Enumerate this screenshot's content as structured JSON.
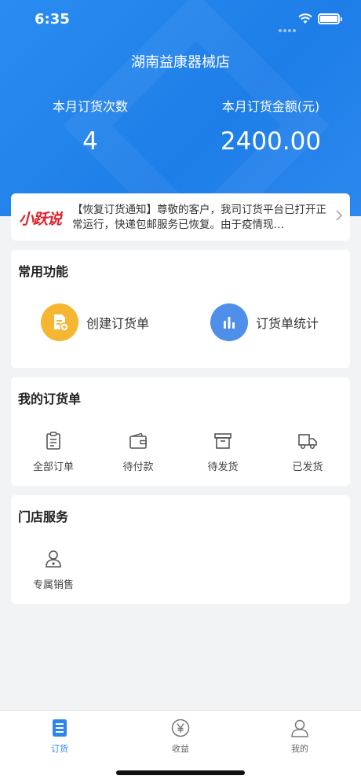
{
  "status_bar": {
    "time": "6:35"
  },
  "header": {
    "store_name": "湖南益康器械店",
    "stats": [
      {
        "label": "本月订货次数",
        "value": "4"
      },
      {
        "label": "本月订货金额(元)",
        "value": "2400.00"
      }
    ]
  },
  "notice": {
    "logo": "小跃说",
    "text": "【恢复订货通知】尊敬的客户，我司订货平台已打开正常运行，快递包邮服务已恢复。由于疫情现…"
  },
  "common_functions": {
    "title": "常用功能",
    "items": [
      {
        "label": "创建订货单",
        "icon": "create-order-icon",
        "color": "#f5b731"
      },
      {
        "label": "订货单统计",
        "icon": "bar-chart-icon",
        "color": "#4f8fe9"
      }
    ]
  },
  "my_orders": {
    "title": "我的订货单",
    "items": [
      {
        "label": "全部订单",
        "icon": "clipboard-icon"
      },
      {
        "label": "待付款",
        "icon": "wallet-icon"
      },
      {
        "label": "待发货",
        "icon": "box-icon"
      },
      {
        "label": "已发货",
        "icon": "truck-icon"
      }
    ]
  },
  "store_services": {
    "title": "门店服务",
    "items": [
      {
        "label": "专属销售",
        "icon": "sales-person-icon"
      }
    ]
  },
  "tabbar": {
    "items": [
      {
        "label": "订货",
        "icon": "order-doc-icon",
        "active": true
      },
      {
        "label": "收益",
        "icon": "yen-icon",
        "active": false
      },
      {
        "label": "我的",
        "icon": "user-icon",
        "active": false
      }
    ]
  },
  "colors": {
    "primary": "#2b87ee",
    "brand_red": "#e0202a"
  }
}
